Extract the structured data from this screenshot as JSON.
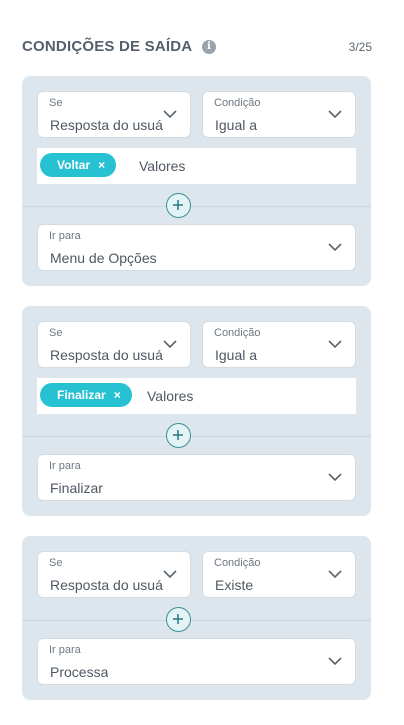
{
  "header": {
    "title": "CONDIÇÕES DE SAÍDA",
    "counter": "3/25",
    "info_icon": "i"
  },
  "conditions": [
    {
      "se_label": "Se",
      "se_value": "Resposta do usuário",
      "cond_label": "Condição",
      "cond_value": "Igual a",
      "chip": "Voltar",
      "chip_remove": "×",
      "values_label": "Valores",
      "ir_label": "Ir para",
      "ir_value": "Menu de Opções"
    },
    {
      "se_label": "Se",
      "se_value": "Resposta do usuário",
      "cond_label": "Condição",
      "cond_value": "Igual a",
      "chip": "Finalizar",
      "chip_remove": "×",
      "values_label": "Valores",
      "ir_label": "Ir para",
      "ir_value": "Finalizar"
    },
    {
      "se_label": "Se",
      "se_value": "Resposta do usuário",
      "cond_label": "Condição",
      "cond_value": "Existe",
      "ir_label": "Ir para",
      "ir_value": "Processa"
    }
  ],
  "icons": {
    "info": "info-icon",
    "dropdown": "chevron-down-icon",
    "add": "plus-icon",
    "remove": "close-icon"
  },
  "colors": {
    "accent": "#27c2d2",
    "card": "#dde6ec",
    "add_border": "#3a8f98"
  }
}
